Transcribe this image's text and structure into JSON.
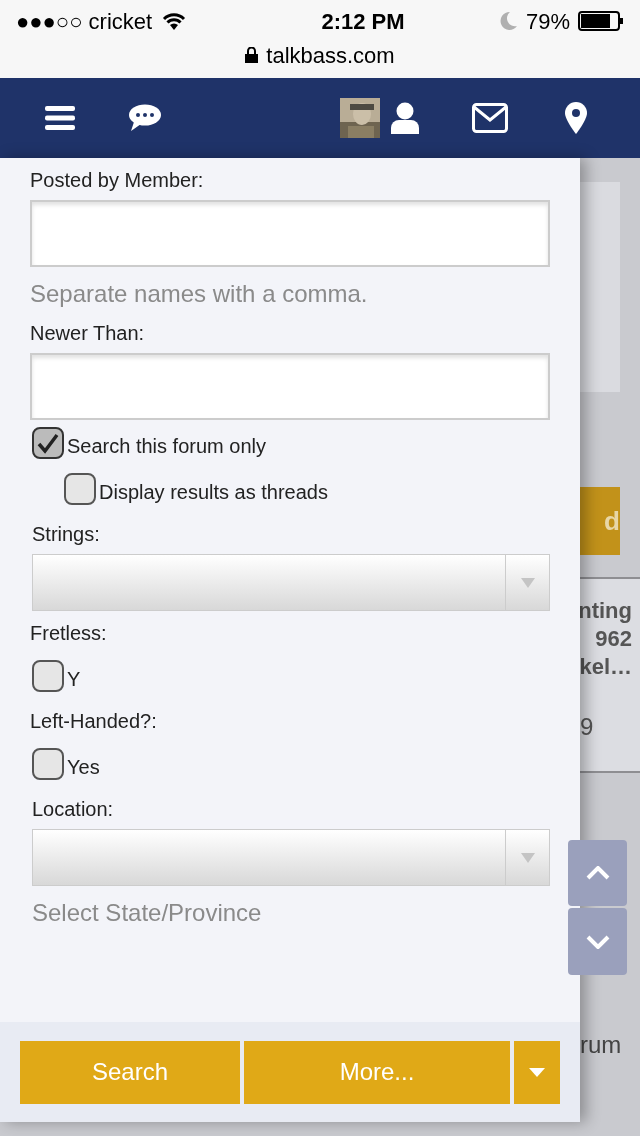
{
  "status_bar": {
    "carrier": "●●●○○ cricket",
    "time": "2:12 PM",
    "battery": "79%",
    "url": "talkbass.com"
  },
  "form": {
    "fields": [
      {
        "kind": "text",
        "label": "Posted by Member:",
        "hint": "Separate names with a comma."
      },
      {
        "kind": "text",
        "label": "Newer Than:"
      },
      {
        "kind": "checkbox",
        "text": "Search this forum only",
        "checked": true,
        "children": [
          {
            "kind": "checkbox",
            "text": "Display results as threads",
            "checked": false
          }
        ]
      },
      {
        "kind": "select",
        "label": "Strings:"
      },
      {
        "kind": "checkbox",
        "label": "Fretless:",
        "text": "Y",
        "checked": false
      },
      {
        "kind": "checkbox",
        "label": "Left-Handed?:",
        "text": "Yes",
        "checked": false
      },
      {
        "kind": "select",
        "label": "Location:",
        "hint": "Select State/Province"
      }
    ]
  },
  "buttons": {
    "search": "Search",
    "more": "More..."
  },
  "background_page": {
    "button": "d",
    "card_lines": [
      "nting",
      "962",
      "kel…"
    ],
    "card_footer": "9",
    "bottom_text": "rum"
  }
}
